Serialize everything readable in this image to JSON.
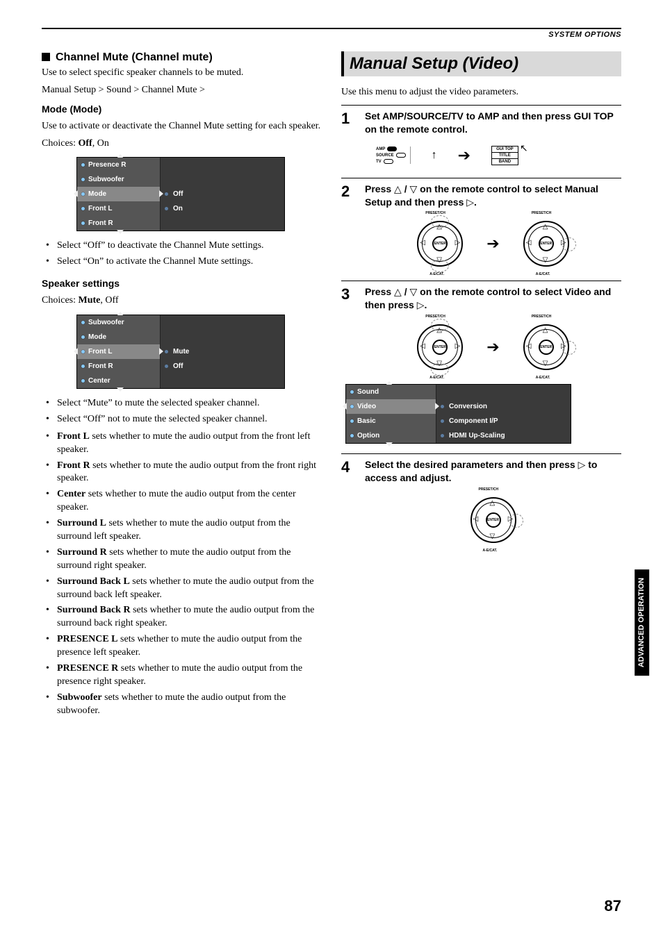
{
  "header": {
    "section": "SYSTEM OPTIONS"
  },
  "left": {
    "h_channel_mute": "Channel Mute (Channel mute)",
    "p_channel_mute": "Use to select specific speaker channels to be muted.",
    "p_path": "Manual Setup > Sound > Channel Mute >",
    "h_mode": "Mode (Mode)",
    "p_mode": "Use to activate or deactivate the Channel Mute setting for each speaker.",
    "p_mode_choices_pre": "Choices: ",
    "p_mode_choices_b": "Off",
    "p_mode_choices_post": ", On",
    "menu1": {
      "left": [
        "Presence R",
        "Subwoofer",
        "Mode",
        "Front L",
        "Front R"
      ],
      "sel_index": 2,
      "right": [
        "Off",
        "On"
      ]
    },
    "bul1": [
      "Select “Off” to deactivate the Channel Mute settings.",
      "Select “On” to activate the Channel Mute settings."
    ],
    "h_speaker": "Speaker settings",
    "p_speaker_choices_pre": "Choices: ",
    "p_speaker_choices_b": "Mute",
    "p_speaker_choices_post": ", Off",
    "menu2": {
      "left": [
        "Subwoofer",
        "Mode",
        "Front L",
        "Front R",
        "Center"
      ],
      "sel_index": 2,
      "right": [
        "Mute",
        "Off"
      ]
    },
    "bul2": [
      "Select “Mute” to mute the selected speaker channel.",
      "Select “Off” not to mute the selected speaker channel."
    ],
    "bul3": [
      {
        "b": "Front L",
        "t": " sets whether to mute the audio output from the front left speaker."
      },
      {
        "b": "Front R",
        "t": " sets whether to mute the audio output from the front right speaker."
      },
      {
        "b": "Center",
        "t": " sets whether to mute the audio output from the center speaker."
      },
      {
        "b": "Surround L",
        "t": " sets whether to mute the audio output from the surround left speaker."
      },
      {
        "b": "Surround R",
        "t": " sets whether to mute the audio output from the surround right speaker."
      },
      {
        "b": "Surround Back L",
        "t": " sets whether to mute the audio output from the surround back left speaker."
      },
      {
        "b": "Surround Back R",
        "t": " sets whether to mute the audio output from the surround back right speaker."
      },
      {
        "b": "PRESENCE L",
        "t": " sets whether to mute the audio output from the presence left speaker."
      },
      {
        "b": "PRESENCE R",
        "t": " sets whether to mute the audio output from the presence right speaker."
      },
      {
        "b": "Subwoofer",
        "t": " sets whether to mute the audio output from the subwoofer."
      }
    ]
  },
  "right": {
    "h_main": "Manual Setup (Video)",
    "p_intro": "Use this menu to adjust the video parameters.",
    "steps": [
      {
        "n": "1",
        "t": "Set AMP/SOURCE/TV to AMP and then press GUI TOP on the remote control."
      },
      {
        "n": "2",
        "t_a": "Press ",
        "t_b": " / ",
        "t_c": " on the remote control to select Manual Setup and then press ",
        "t_d": "."
      },
      {
        "n": "3",
        "t_a": "Press ",
        "t_b": " / ",
        "t_c": " on the remote control to select Video and then press ",
        "t_d": "."
      },
      {
        "n": "4",
        "t_a": "Select the desired parameters and then press ",
        "t_b": " to access and adjust."
      }
    ],
    "remote_labels": {
      "amp": "AMP",
      "source": "SOURCE",
      "tv": "TV"
    },
    "gui_keys": [
      "GUI TOP",
      "TITLE",
      "BAND"
    ],
    "dpad": {
      "enter": "ENTER",
      "top": "PRESET/CH",
      "bot": "A-E/CAT."
    },
    "menu3": {
      "left_pre": "Sound",
      "left": [
        "Sound",
        "Video",
        "Basic",
        "Option"
      ],
      "sel_index": 1,
      "right": [
        "Conversion",
        "Component I/P",
        "HDMI Up-Scaling"
      ]
    }
  },
  "sidetab": "ADVANCED OPERATION",
  "pagenum": "87"
}
